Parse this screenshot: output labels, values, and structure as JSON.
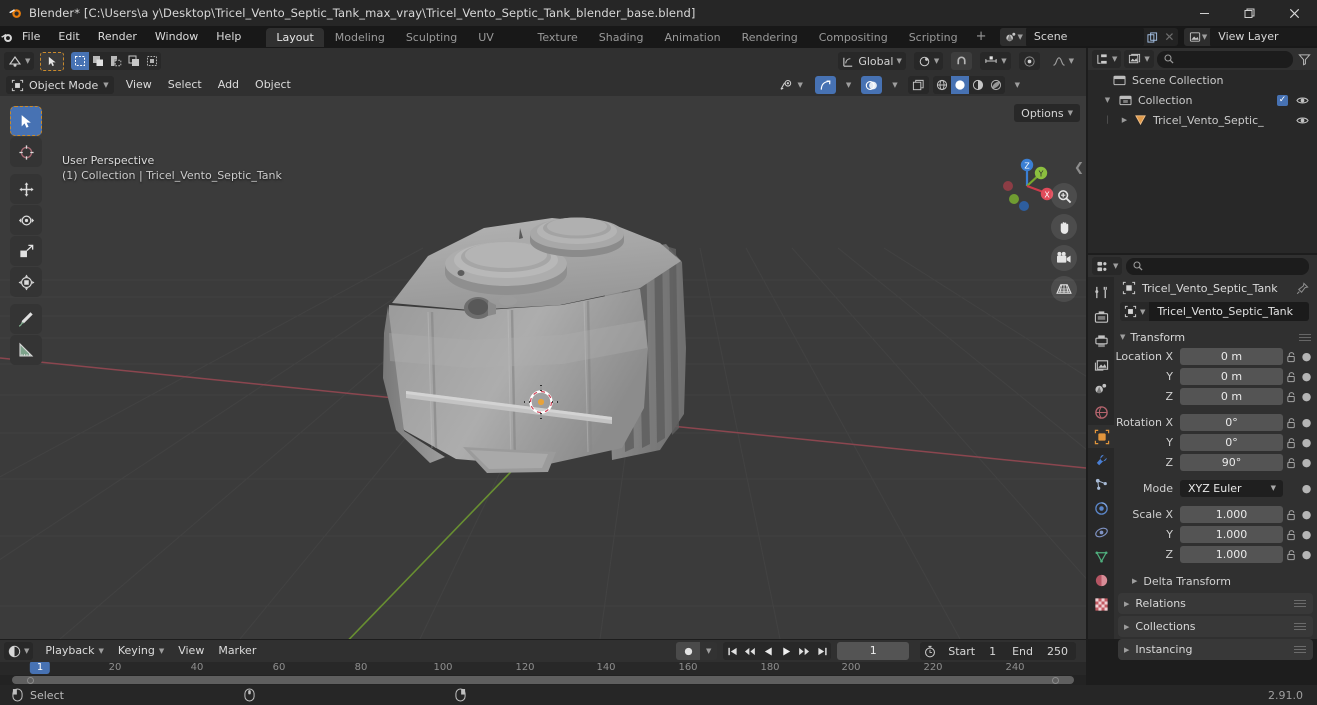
{
  "window": {
    "title": "Blender* [C:\\Users\\a y\\Desktop\\Tricel_Vento_Septic_Tank_max_vray\\Tricel_Vento_Septic_Tank_blender_base.blend]",
    "minimize": "–",
    "maximize": "❐",
    "close": "✕"
  },
  "topbar": {
    "menus": [
      "File",
      "Edit",
      "Render",
      "Window",
      "Help"
    ],
    "workspace_tabs": [
      {
        "label": "Layout",
        "active": true
      },
      {
        "label": "Modeling",
        "active": false
      },
      {
        "label": "Sculpting",
        "active": false
      },
      {
        "label": "UV Editing",
        "active": false
      },
      {
        "label": "Texture Paint",
        "active": false
      },
      {
        "label": "Shading",
        "active": false
      },
      {
        "label": "Animation",
        "active": false
      },
      {
        "label": "Rendering",
        "active": false
      },
      {
        "label": "Compositing",
        "active": false
      },
      {
        "label": "Scripting",
        "active": false
      }
    ],
    "add_workspace": "+",
    "scene_name": "Scene",
    "view_layer_name": "View Layer",
    "new_scene_icon": "copy-icon",
    "remove_scene_icon": "x-icon"
  },
  "viewport": {
    "header": {
      "editor_type_icon": "editor-type-icon",
      "mode": "Object Mode",
      "menus": [
        "View",
        "Select",
        "Add",
        "Object"
      ],
      "transform_orientation": "Global",
      "snap_icon": "magnet-icon",
      "proportional_icon": "proportional-edit-icon",
      "options_label": "Options"
    },
    "overlay_text": {
      "line1": "User Perspective",
      "line2": "(1) Collection | Tricel_Vento_Septic_Tank"
    },
    "shading_modes": [
      "wireframe",
      "solid",
      "material-preview",
      "rendered"
    ],
    "active_shading": "solid",
    "gizmo_axes": [
      "Z",
      "Y",
      "X"
    ],
    "nav_buttons": [
      "zoom-icon",
      "hand-icon",
      "camera-icon",
      "grid-icon"
    ],
    "toolbar_tools": [
      "tweak-select-tool",
      "cursor-tool",
      "move-tool",
      "rotate-tool",
      "scale-tool",
      "transform-tool",
      "annotate-tool",
      "measure-tool"
    ],
    "background_color": "#3b3b3b",
    "x_axis_color": "#9c4a52",
    "y_axis_color": "#6f9c31",
    "object_color": "#a0a0a0"
  },
  "outliner": {
    "display_mode_icon": "outliner-display-icon",
    "filter_icon": "filter-icon",
    "search_placeholder": "",
    "rows": [
      {
        "label": "Scene Collection",
        "indent": 0,
        "icon": "collection-icon",
        "has_tri": false,
        "checkbox": false,
        "eye": false
      },
      {
        "label": "Collection",
        "indent": 1,
        "icon": "collection-icon",
        "has_tri": true,
        "checkbox": true,
        "eye": true
      },
      {
        "label": "Tricel_Vento_Septic_",
        "indent": 2,
        "icon": "mesh-object-icon",
        "has_tri": true,
        "checkbox": false,
        "eye": true
      }
    ]
  },
  "properties": {
    "editor_icon": "properties-editor-icon",
    "search_placeholder": "",
    "breadcrumb_object": "Tricel_Vento_Septic_Tank",
    "pin_icon": "pin-icon",
    "object_name": "Tricel_Vento_Septic_Tank",
    "tabs": [
      {
        "name": "tool",
        "active": false
      },
      {
        "name": "render",
        "active": false
      },
      {
        "name": "output",
        "active": false
      },
      {
        "name": "view-layer",
        "active": false
      },
      {
        "name": "scene",
        "active": false
      },
      {
        "name": "world",
        "active": false
      },
      {
        "name": "object",
        "active": true
      },
      {
        "name": "modifiers",
        "active": false
      },
      {
        "name": "particles",
        "active": false
      },
      {
        "name": "physics",
        "active": false
      },
      {
        "name": "constraints",
        "active": false
      },
      {
        "name": "object-data",
        "active": false
      },
      {
        "name": "material",
        "active": false
      },
      {
        "name": "texture",
        "active": false
      }
    ],
    "transform_panel": {
      "title": "Transform",
      "fields": [
        {
          "label": "Location X",
          "value": "0 m"
        },
        {
          "label": "Y",
          "value": "0 m"
        },
        {
          "label": "Z",
          "value": "0 m"
        },
        {
          "label": "Rotation X",
          "value": "0°"
        },
        {
          "label": "Y",
          "value": "0°"
        },
        {
          "label": "Z",
          "value": "90°"
        },
        {
          "label": "Mode",
          "value": "XYZ Euler",
          "dropdown": true
        },
        {
          "label": "Scale X",
          "value": "1.000"
        },
        {
          "label": "Y",
          "value": "1.000"
        },
        {
          "label": "Z",
          "value": "1.000"
        }
      ],
      "delta_transform": "Delta Transform"
    },
    "closed_panels": [
      "Relations",
      "Collections",
      "Instancing"
    ]
  },
  "timeline": {
    "editor_icon": "timeline-editor-icon",
    "menus": [
      "Playback",
      "Keying",
      "View",
      "Marker"
    ],
    "record_icon": "record-icon",
    "transport": [
      "jump-start",
      "prev-keyframe",
      "play-reverse",
      "play",
      "next-keyframe",
      "jump-end"
    ],
    "current_frame": "1",
    "auto_key_icon": "stopwatch-icon",
    "start_label": "Start",
    "start_value": "1",
    "end_label": "End",
    "end_value": "250",
    "ruler_ticks": [
      "20",
      "40",
      "60",
      "80",
      "100",
      "120",
      "140",
      "160",
      "180",
      "200",
      "220",
      "240"
    ],
    "playhead_frame": "1"
  },
  "statusbar": {
    "mouse_left_icon": "mouse-left-icon",
    "mouse_left_label": "Select",
    "mouse_middle_icon": "mouse-middle-icon",
    "mouse_right_icon": "mouse-right-icon",
    "version": "2.91.0"
  }
}
